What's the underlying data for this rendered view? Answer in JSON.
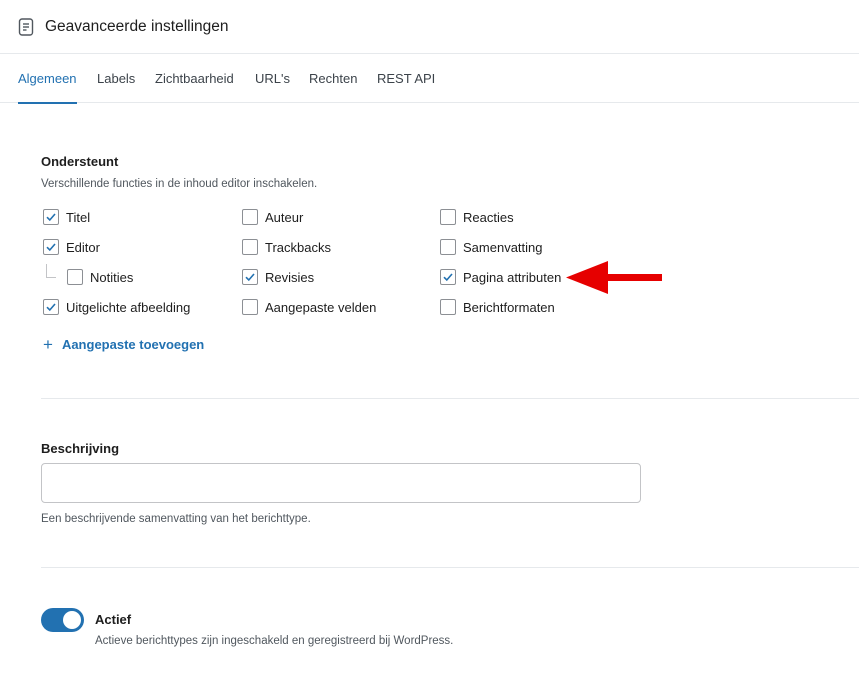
{
  "header": {
    "title": "Geavanceerde instellingen",
    "icon": "document-icon"
  },
  "tabs": [
    {
      "label": "Algemeen",
      "active": true
    },
    {
      "label": "Labels",
      "active": false
    },
    {
      "label": "Zichtbaarheid",
      "active": false
    },
    {
      "label": "URL's",
      "active": false
    },
    {
      "label": "Rechten",
      "active": false
    },
    {
      "label": "REST API",
      "active": false
    }
  ],
  "supports": {
    "title": "Ondersteunt",
    "description": "Verschillende functies in de inhoud editor inschakelen.",
    "options": [
      {
        "label": "Titel",
        "checked": true
      },
      {
        "label": "Auteur",
        "checked": false
      },
      {
        "label": "Reacties",
        "checked": false
      },
      {
        "label": "Editor",
        "checked": true
      },
      {
        "label": "Trackbacks",
        "checked": false
      },
      {
        "label": "Samenvatting",
        "checked": false
      },
      {
        "label": "Notities",
        "checked": false
      },
      {
        "label": "Revisies",
        "checked": true
      },
      {
        "label": "Pagina attributen",
        "checked": true
      },
      {
        "label": "Uitgelichte afbeelding",
        "checked": true
      },
      {
        "label": "Aangepaste velden",
        "checked": false
      },
      {
        "label": "Berichtformaten",
        "checked": false
      }
    ],
    "add_custom_label": "Aangepaste toevoegen"
  },
  "description_field": {
    "title": "Beschrijving",
    "value": "",
    "placeholder": "",
    "help": "Een beschrijvende samenvatting van het berichttype."
  },
  "active_toggle": {
    "title": "Actief",
    "on": true,
    "help": "Actieve berichttypes zijn ingeschakeld en geregistreerd bij WordPress."
  },
  "colors": {
    "accent": "#2271b1",
    "annotation_arrow": "#e60000"
  }
}
